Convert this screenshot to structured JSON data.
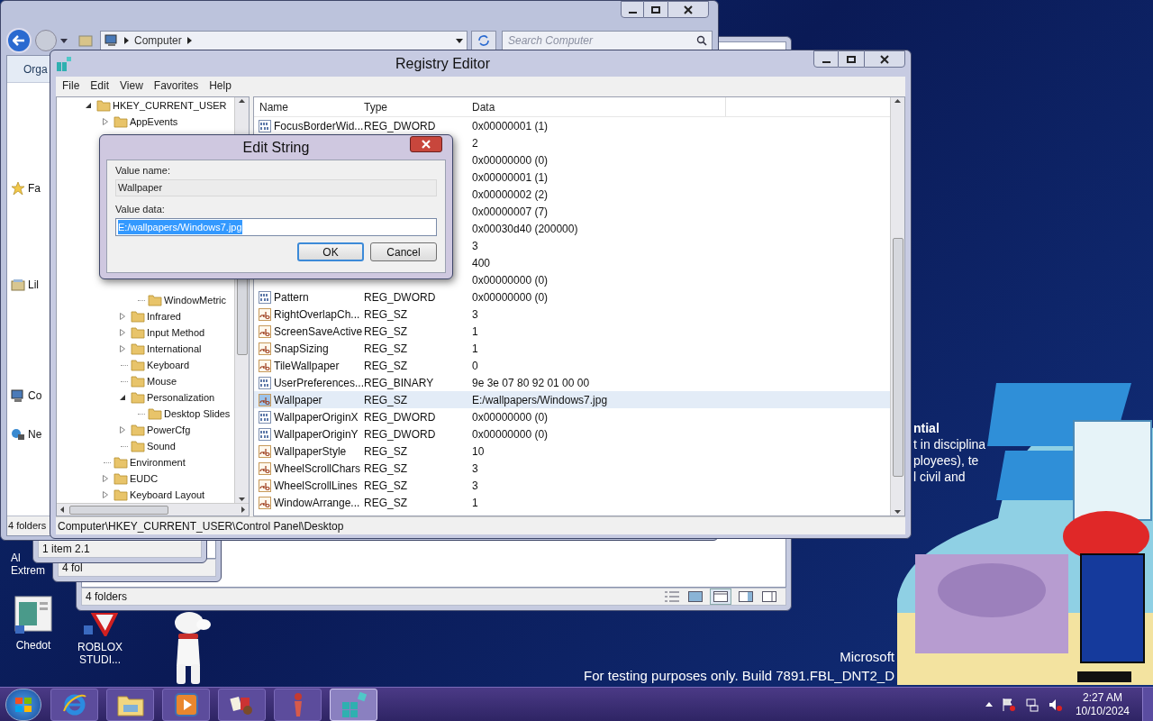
{
  "explorer": {
    "address": "Computer",
    "search": {
      "placeholder": "Search Computer"
    },
    "toolbar": "Orga",
    "sidebar": [
      {
        "label": "Fa",
        "kind": "favorites"
      },
      {
        "label": "Lil",
        "kind": "libraries"
      },
      {
        "label": "Co",
        "kind": "computer"
      },
      {
        "label": "Ne",
        "kind": "network"
      }
    ],
    "status": "4 folders"
  },
  "background_windows": [
    {
      "status": "1 item 2.1",
      "kind": "plain"
    },
    {
      "status": "4 fol",
      "kind": "plain"
    },
    {
      "status": "4 folders",
      "kind": "views"
    }
  ],
  "registry_editor": {
    "title": "Registry Editor",
    "menu": [
      "File",
      "Edit",
      "View",
      "Favorites",
      "Help"
    ],
    "tree": [
      {
        "label": "HKEY_CURRENT_USER",
        "kind": "branch",
        "expanded": true,
        "children": [
          {
            "label": "AppEvents",
            "kind": "branch",
            "expanded": false
          },
          {
            "children": [
              {
                "children": [
                  {
                    "label": "WindowMetric",
                    "kind": "leaf"
                  }
                ]
              },
              {
                "label": "Infrared",
                "kind": "branch",
                "expanded": false
              },
              {
                "label": "Input Method",
                "kind": "branch",
                "expanded": false
              },
              {
                "label": "International",
                "kind": "branch",
                "expanded": false
              },
              {
                "label": "Keyboard",
                "kind": "leaf"
              },
              {
                "label": "Mouse",
                "kind": "leaf"
              },
              {
                "label": "Personalization",
                "kind": "branch",
                "expanded": true,
                "children": [
                  {
                    "label": "Desktop Slides",
                    "kind": "leaf"
                  }
                ]
              },
              {
                "label": "PowerCfg",
                "kind": "branch",
                "expanded": false
              },
              {
                "label": "Sound",
                "kind": "leaf"
              }
            ]
          },
          {
            "label": "Environment",
            "kind": "leaf"
          },
          {
            "label": "EUDC",
            "kind": "branch",
            "expanded": false
          },
          {
            "label": "Keyboard Layout",
            "kind": "branch",
            "expanded": false
          }
        ]
      }
    ],
    "columns": [
      "Name",
      "Type",
      "Data"
    ],
    "rows": [
      {
        "kind": "binary",
        "name": "FocusBorderWid...",
        "type": "REG_DWORD",
        "data": "0x00000001 (1)",
        "selected": false
      },
      {
        "data": "2",
        "selected": false
      },
      {
        "data": "0x00000000 (0)",
        "selected": false
      },
      {
        "data": "0x00000001 (1)",
        "selected": false
      },
      {
        "data": "0x00000002 (2)",
        "selected": false
      },
      {
        "data": "0x00000007 (7)",
        "selected": false
      },
      {
        "data": "0x00030d40 (200000)",
        "selected": false
      },
      {
        "data": "3",
        "selected": false
      },
      {
        "data": "400",
        "selected": false
      },
      {
        "data": "0x00000000 (0)",
        "selected": false
      },
      {
        "kind": "binary",
        "name": "Pattern",
        "type": "REG_DWORD",
        "data": "0x00000000 (0)",
        "selected": false
      },
      {
        "kind": "string",
        "name": "RightOverlapCh...",
        "type": "REG_SZ",
        "data": "3",
        "selected": false
      },
      {
        "kind": "string",
        "name": "ScreenSaveActive",
        "type": "REG_SZ",
        "data": "1",
        "selected": false
      },
      {
        "kind": "string",
        "name": "SnapSizing",
        "type": "REG_SZ",
        "data": "1",
        "selected": false
      },
      {
        "kind": "string",
        "name": "TileWallpaper",
        "type": "REG_SZ",
        "data": "0",
        "selected": false
      },
      {
        "kind": "binary",
        "name": "UserPreferences...",
        "type": "REG_BINARY",
        "data": "9e 3e 07 80 92 01 00 00",
        "selected": false
      },
      {
        "kind": "string",
        "name": "Wallpaper",
        "type": "REG_SZ",
        "data": "E:/wallpapers/Windows7.jpg",
        "selected": true
      },
      {
        "kind": "binary",
        "name": "WallpaperOriginX",
        "type": "REG_DWORD",
        "data": "0x00000000 (0)",
        "selected": false
      },
      {
        "kind": "binary",
        "name": "WallpaperOriginY",
        "type": "REG_DWORD",
        "data": "0x00000000 (0)",
        "selected": false
      },
      {
        "kind": "string",
        "name": "WallpaperStyle",
        "type": "REG_SZ",
        "data": "10",
        "selected": false
      },
      {
        "kind": "string",
        "name": "WheelScrollChars",
        "type": "REG_SZ",
        "data": "3",
        "selected": false
      },
      {
        "kind": "string",
        "name": "WheelScrollLines",
        "type": "REG_SZ",
        "data": "3",
        "selected": false
      },
      {
        "kind": "string",
        "name": "WindowArrange...",
        "type": "REG_SZ",
        "data": "1",
        "selected": false
      }
    ],
    "status_bar": "Computer\\HKEY_CURRENT_USER\\Control Panel\\Desktop"
  },
  "dialog": {
    "title": "Edit String",
    "value_name_label": "Value name:",
    "value_name": "Wallpaper",
    "value_data_label": "Value data:",
    "value_data": "E:/wallpapers/Windows7.jpg",
    "value_data_selected": true,
    "buttons": [
      {
        "label": "OK",
        "focused": true
      },
      {
        "label": "Cancel",
        "focused": false
      }
    ]
  },
  "desktop_icons": [
    {
      "kind": "partial",
      "lines": [
        "Al",
        "Extrem"
      ]
    },
    {
      "kind": "app",
      "lines": [
        "Chedot"
      ]
    },
    {
      "kind": "shortcut",
      "lines": [
        "ROBLOX",
        "STUDI..."
      ]
    }
  ],
  "desktop_text": [
    {
      "text": "ntial",
      "bold": true
    },
    {
      "text": "t in disciplina",
      "bold": false
    },
    {
      "text": "ployees), te",
      "bold": false
    },
    {
      "text": "l civil and",
      "bold": false
    }
  ],
  "build_notice": [
    "Microsoft",
    "For testing purposes only. Build 7891.FBL_DNT2_D"
  ],
  "gadget": {
    "kind": "picture"
  },
  "desktop_figure": {
    "kind": "picture"
  },
  "taskbar": {
    "buttons": [
      {
        "kind": "browser",
        "active": false
      },
      {
        "kind": "folder",
        "active": false
      },
      {
        "kind": "media",
        "active": false
      },
      {
        "kind": "games",
        "active": false
      },
      {
        "kind": "doll",
        "active": false
      },
      {
        "kind": "registry",
        "active": true
      }
    ],
    "clock": {
      "time": "2:27 AM",
      "date": "10/10/2024"
    }
  }
}
